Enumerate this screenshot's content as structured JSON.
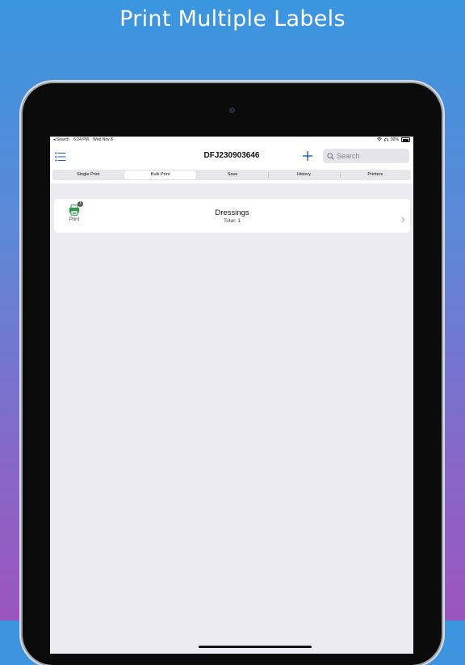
{
  "headline": "Print Multiple Labels",
  "status": {
    "back": "◂ Search",
    "time": "6:24 PM",
    "date": "Wed Nov 8",
    "battery": "92%"
  },
  "nav": {
    "title": "DFJ230903646",
    "search_placeholder": "Search"
  },
  "tabs": [
    {
      "label": "Single Print",
      "active": false
    },
    {
      "label": "Bulk Print",
      "active": true
    },
    {
      "label": "Save",
      "active": false
    },
    {
      "label": "History",
      "active": false
    },
    {
      "label": "Printers",
      "active": false
    }
  ],
  "bulk": {
    "print_label": "Print",
    "badge_count": "1",
    "group_title": "Dressings",
    "group_total": "Total: 1"
  },
  "colors": {
    "accent": "#1a57c4",
    "print_green": "#2e9b4a"
  }
}
